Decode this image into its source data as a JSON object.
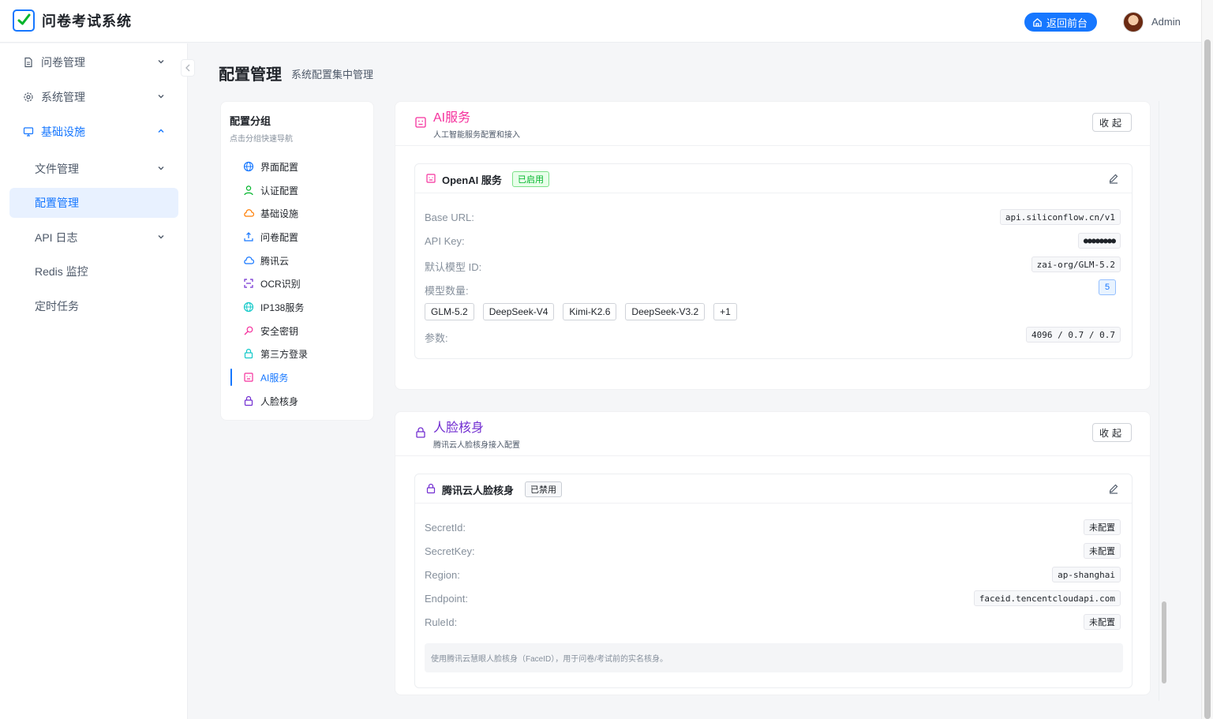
{
  "app": {
    "title": "问卷考试系统"
  },
  "header": {
    "home_button": "返回前台",
    "user_name": "Admin"
  },
  "sidebar": {
    "items": [
      {
        "label": "问卷管理",
        "icon": "document-icon",
        "expandable": true
      },
      {
        "label": "系统管理",
        "icon": "gear-icon",
        "expandable": true
      },
      {
        "label": "基础设施",
        "icon": "monitor-icon",
        "expandable": true,
        "open": true
      },
      {
        "label": "文件管理",
        "expandable": true
      },
      {
        "label": "配置管理",
        "active": true
      },
      {
        "label": "API 日志",
        "expandable": true
      },
      {
        "label": "Redis 监控"
      },
      {
        "label": "定时任务"
      }
    ]
  },
  "page": {
    "title": "配置管理",
    "subtitle": "系统配置集中管理"
  },
  "groups": {
    "title": "配置分组",
    "hint": "点击分组快速导航",
    "items": [
      {
        "label": "界面配置",
        "icon": "globe-icon",
        "color": "#1677ff"
      },
      {
        "label": "认证配置",
        "icon": "user-icon",
        "color": "#00b42a"
      },
      {
        "label": "基础设施",
        "icon": "cloud-icon",
        "color": "#ff7d00"
      },
      {
        "label": "问卷配置",
        "icon": "upload-icon",
        "color": "#1677ff"
      },
      {
        "label": "腾讯云",
        "icon": "cloud-icon",
        "color": "#1677ff"
      },
      {
        "label": "OCR识别",
        "icon": "scan-icon",
        "color": "#722ed1"
      },
      {
        "label": "IP138服务",
        "icon": "globe-icon",
        "color": "#14c9c9"
      },
      {
        "label": "安全密钥",
        "icon": "key-icon",
        "color": "#f5319d"
      },
      {
        "label": "第三方登录",
        "icon": "lock-icon",
        "color": "#14c9c9"
      },
      {
        "label": "AI服务",
        "icon": "robot-icon",
        "color": "#f5319d",
        "active": true
      },
      {
        "label": "人脸核身",
        "icon": "lock-icon",
        "color": "#722ed1"
      }
    ]
  },
  "ai_section": {
    "title": "AI服务",
    "subtitle": "人工智能服务配置和接入",
    "collapse_label": "收起",
    "color": "#f5319d",
    "card": {
      "title": "OpenAI 服务",
      "status": "已启用",
      "fields": [
        {
          "label": "Base URL:",
          "value": "api.siliconflow.cn/v1"
        },
        {
          "label": "API Key:",
          "value": "●●●●●●●●"
        },
        {
          "label": "默认模型 ID:",
          "value": "zai-org/GLM-5.2"
        },
        {
          "label": "模型数量:",
          "value": "5"
        },
        {
          "label": "参数:",
          "value": "4096 / 0.7 / 0.7"
        }
      ],
      "models": [
        "GLM-5.2",
        "DeepSeek-V4",
        "Kimi-K2.6",
        "DeepSeek-V3.2",
        "+1"
      ]
    }
  },
  "face_section": {
    "title": "人脸核身",
    "subtitle": "腾讯云人脸核身接入配置",
    "collapse_label": "收起",
    "color": "#722ed1",
    "card": {
      "title": "腾讯云人脸核身",
      "status": "已禁用",
      "fields": [
        {
          "label": "SecretId:",
          "value": "未配置"
        },
        {
          "label": "SecretKey:",
          "value": "未配置"
        },
        {
          "label": "Region:",
          "value": "ap-shanghai"
        },
        {
          "label": "Endpoint:",
          "value": "faceid.tencentcloudapi.com"
        },
        {
          "label": "RuleId:",
          "value": "未配置"
        }
      ],
      "note": "使用腾讯云慧眼人脸核身（FaceID），用于问卷/考试前的实名核身。"
    }
  }
}
